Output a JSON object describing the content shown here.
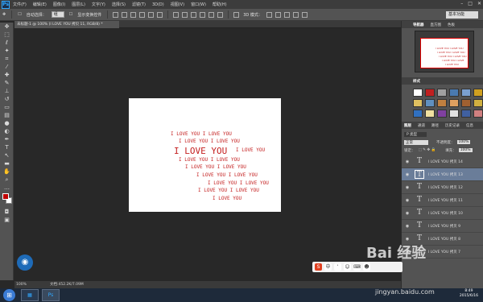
{
  "menu": {
    "logo": "Ps",
    "items": [
      "文件(F)",
      "编辑(E)",
      "图像(I)",
      "图层(L)",
      "文字(Y)",
      "选择(S)",
      "滤镜(T)",
      "3D(D)",
      "视图(V)",
      "窗口(W)",
      "帮助(H)"
    ]
  },
  "options": {
    "auto_select": "自动选择：",
    "auto_select_value": "组",
    "show_transform": "显示变换控件",
    "mode_3d": "3D 模式：",
    "workspace": "基本功能"
  },
  "document": {
    "tab": "未标题-1 @ 100% (I LOVE YOU 拷贝 11, RGB/8) *",
    "status_zoom": "100%",
    "status_doc": "文档:452.2K/7.09M"
  },
  "canvas_text": [
    "I LOVE YOU I LOVE YOU",
    "I LOVE YOU  I LOVE YOU",
    "I LOVE YOU",
    "I LOVE YOU",
    "I LOVE YOU  I LOVE YOU",
    "I LOVE YOU   I LOVE YOU",
    "I LOVE YOU   I LOVE YOU",
    "I LOVE YOU I LOVE YOU",
    "I LOVE YOU  I LOVE YOU",
    "I LOVE YOU"
  ],
  "panels": {
    "top_tabs": [
      "导航器",
      "直方图",
      "色板"
    ],
    "mid_tabs": [
      "样式"
    ],
    "layer_tabs": [
      "图层",
      "通道",
      "路径",
      "历史记录",
      "信息"
    ],
    "kind": "P 类型",
    "blend": "正常",
    "opacity_label": "不透明度：",
    "opacity_value": "100%",
    "lock_label": "锁定：",
    "fill_label": "填充：",
    "fill_value": "100%"
  },
  "layers": [
    {
      "name": "I LOVE YOU 拷贝 14",
      "selected": false
    },
    {
      "name": "I LOVE YOU 拷贝 13",
      "selected": true
    },
    {
      "name": "I LOVE YOU 拷贝 12",
      "selected": false
    },
    {
      "name": "I LOVE YOU 拷贝 11",
      "selected": false
    },
    {
      "name": "I LOVE YOU 拷贝 10",
      "selected": false
    },
    {
      "name": "I LOVE YOU 拷贝 9",
      "selected": false
    },
    {
      "name": "I LOVE YOU 拷贝 8",
      "selected": false
    },
    {
      "name": "I LOVE YOU 拷贝 7",
      "selected": false
    }
  ],
  "taskbar": {
    "start": "⊞",
    "app": "Ps",
    "time": "8:49",
    "date": "2015/6/16"
  },
  "watermark": {
    "main": "Bai 经验",
    "url": "jingyan.baidu.com"
  },
  "colors": {
    "accent": "#31a8ff",
    "text_red": "#c42020",
    "selected_layer": "#6a7d99"
  }
}
